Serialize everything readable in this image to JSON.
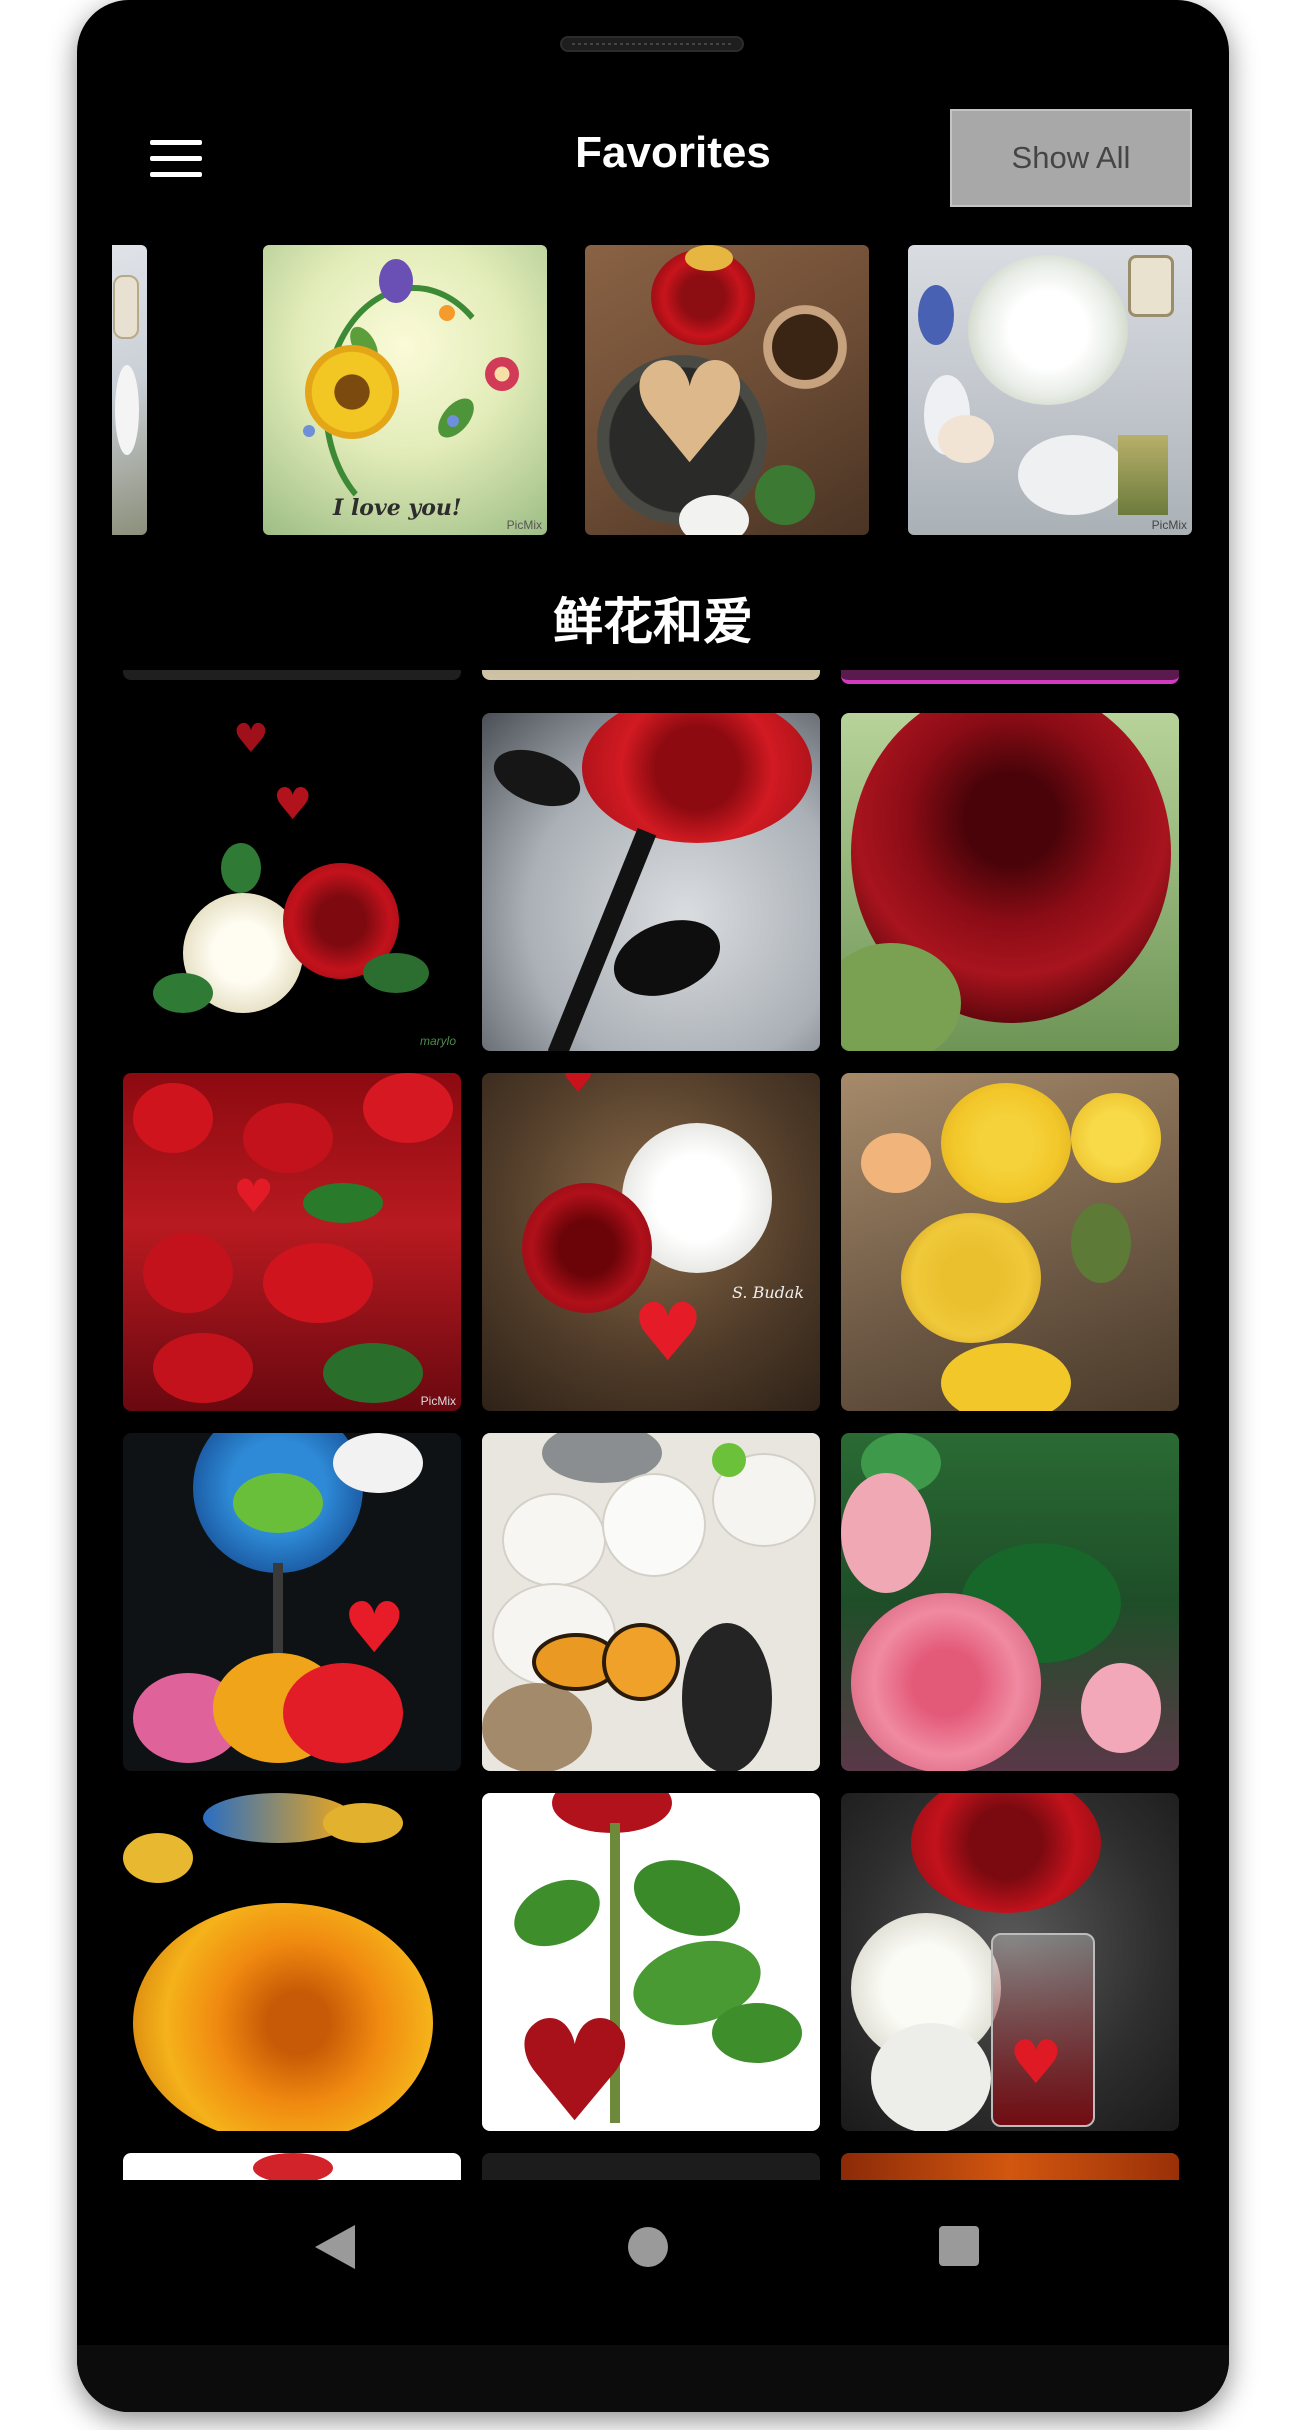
{
  "header": {
    "title": "Favorites",
    "show_all_label": "Show All"
  },
  "carousel": {
    "items": [
      {
        "name": "sunflower-i-love-you",
        "caption_text": "I love you!",
        "watermark": "PicMix"
      },
      {
        "name": "rose-coffee-heart-cookie",
        "watermark": ""
      },
      {
        "name": "white-flowers-vase-cat",
        "watermark": "PicMix"
      }
    ]
  },
  "section": {
    "caption": "鲜花和爱"
  },
  "grid": {
    "tiles": [
      {
        "name": "red-white-roses-black",
        "signature": "marylo"
      },
      {
        "name": "red-rose-shadow",
        "signature": ""
      },
      {
        "name": "dark-red-rose-closeup",
        "signature": ""
      },
      {
        "name": "red-roses-hearts-sparkle",
        "signature": "PicMix"
      },
      {
        "name": "red-white-roses-wood",
        "signature": "S. Budak"
      },
      {
        "name": "yellow-roses",
        "signature": ""
      },
      {
        "name": "wine-glass-tulips-dove",
        "signature": ""
      },
      {
        "name": "butterfly-white-stones",
        "signature": ""
      },
      {
        "name": "pink-roses-green-leaves",
        "signature": ""
      },
      {
        "name": "orange-rose-butterfly",
        "signature": ""
      },
      {
        "name": "red-rose-heart-white",
        "signature": ""
      },
      {
        "name": "red-white-roses-jar-heart",
        "signature": ""
      }
    ]
  },
  "navbar": {
    "icons": [
      "back-icon",
      "home-icon",
      "recents-icon"
    ]
  },
  "colors": {
    "background": "#000000",
    "button_bg": "#a8a8a8",
    "button_text": "#454545",
    "nav_icon": "#9a9a9a"
  }
}
